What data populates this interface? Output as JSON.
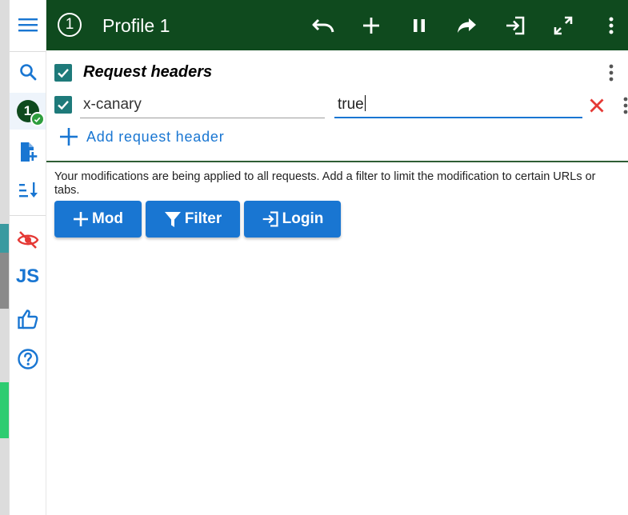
{
  "header": {
    "profile_number": "1",
    "profile_name": "Profile 1"
  },
  "sidebar": {
    "profile_badge": "1",
    "js_label": "JS"
  },
  "section": {
    "title": "Request headers"
  },
  "headers": [
    {
      "name": "x-canary",
      "value": "true",
      "enabled": true
    }
  ],
  "add_header_label": "Add request header",
  "info_text": "Your modifications are being applied to all requests. Add a filter to limit the modification to certain URLs or tabs.",
  "buttons": {
    "mod": "Mod",
    "filter": "Filter",
    "login": "Login"
  },
  "colors": {
    "header_bg": "#0f4a1e",
    "accent": "#1976d2",
    "checkbox": "#1e7a7a",
    "delete": "#e53935"
  }
}
